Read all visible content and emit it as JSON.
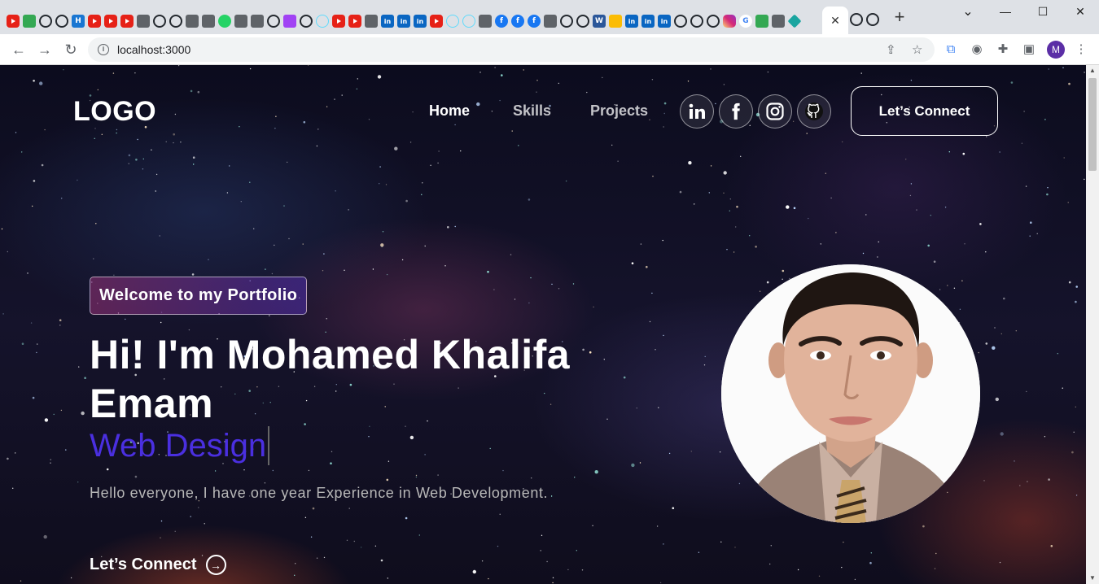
{
  "browser": {
    "url": "localhost:3000",
    "active_tab_close": "✕",
    "new_tab": "+",
    "profile_initial": "M",
    "window_controls": {
      "minimize": "—",
      "maximize": "☐",
      "close": "✕",
      "tab_list": "⌄"
    }
  },
  "tab_icons": [
    "yt",
    "green",
    "gh",
    "gh",
    "h",
    "yt",
    "yt",
    "yt",
    "misc",
    "gh",
    "gh",
    "misc",
    "misc",
    "wa",
    "misc",
    "misc",
    "gh",
    "purple",
    "gh",
    "react",
    "yt",
    "yt",
    "misc",
    "li",
    "li",
    "li",
    "yt",
    "react",
    "react",
    "misc",
    "fb",
    "fb",
    "fb",
    "misc",
    "gh",
    "gh",
    "word",
    "drive",
    "li",
    "li",
    "li",
    "gh",
    "gh",
    "gh",
    "ig",
    "gg",
    "green",
    "misc",
    "teal"
  ],
  "nav": {
    "logo": "LOGO",
    "links": [
      "Home",
      "Skills",
      "Projects"
    ],
    "social": [
      "linkedin-icon",
      "facebook-icon",
      "instagram-icon",
      "github-icon"
    ],
    "connect_label": "Let’s Connect"
  },
  "hero": {
    "badge": "Welcome to my Portfolio",
    "title": "Hi! I'm Mohamed Khalifa Emam",
    "role": "Web Design",
    "description": "Hello everyone, I have one year Experience in Web Development.",
    "connect_label": "Let’s Connect",
    "photo_alt": "portrait"
  },
  "colors": {
    "accent_role": "#4a2fe0",
    "badge_gradient_start": "#aa367c",
    "badge_gradient_end": "#4a2fbd"
  }
}
